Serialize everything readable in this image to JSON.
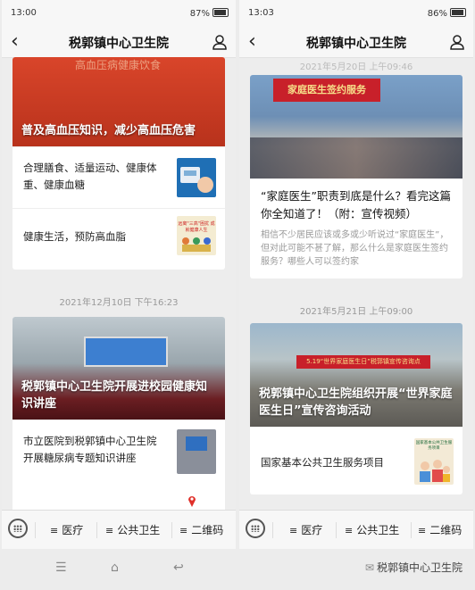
{
  "app_title": "税郭镇中心卫生院",
  "left_phone": {
    "status": {
      "time": "13:00",
      "battery": "87%"
    },
    "top_card": {
      "banner_text": "高血压病健康饮食",
      "cover_title": "普及高血压知识，减少高血压危害",
      "items": [
        {
          "text": "合理膳食、适量运动、健康体重、健康血糖"
        },
        {
          "text": "健康生活，预防高血脂",
          "thumb_caption": "远离\"三高\"困扰 成就健康人生"
        }
      ]
    },
    "date": "2021年12月10日 下午16:23",
    "second_card": {
      "cover_title": "税郭镇中心卫生院开展进校园健康知识讲座",
      "items": [
        {
          "text": "市立医院到税郭镇中心卫生院开展糖尿病专题知识讲座"
        }
      ]
    }
  },
  "right_phone": {
    "status": {
      "time": "13:03",
      "battery": "86%"
    },
    "top_date": "2021年5月20日 上午09:46",
    "first_card": {
      "banner_text": "家庭医生签约服务",
      "title": "“家庭医生”职责到底是什么？看完这篇你全知道了！（附：宣传视频）",
      "desc": "相信不少居民应该或多或少听说过“家庭医生”，但对此可能不甚了解，那么什么是家庭医生签约服务？哪些人可以签约家"
    },
    "date": "2021年5月21日 上午09:00",
    "second_card": {
      "banner_text": "5.19“世界家庭医生日”税郭镇宣传咨询点",
      "cover_title": "税郭镇中心卫生院组织开展“世界家庭医生日”宣传咨询活动",
      "items": [
        {
          "text": "国家基本公共卫生服务项目",
          "thumb_caption": "国家基本公共卫生服务项目"
        }
      ]
    }
  },
  "tabs": [
    "医疗",
    "公共卫生",
    "二维码"
  ],
  "watermark": "税郭镇中心卫生院"
}
